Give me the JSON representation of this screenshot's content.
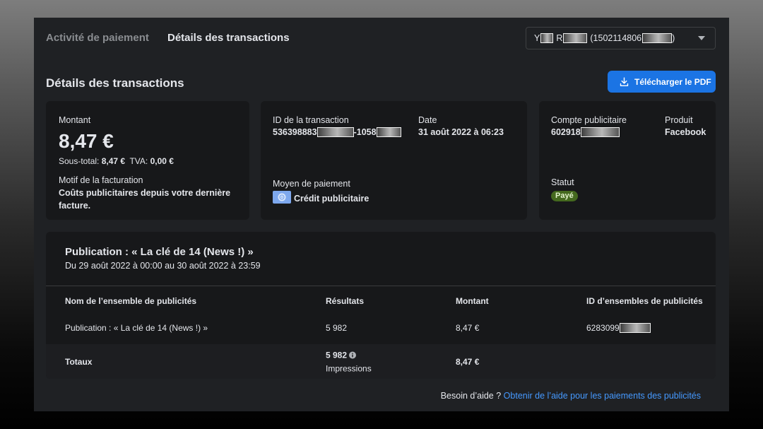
{
  "tabs": {
    "payment_activity": "Activité de paiement",
    "transaction_details": "Détails des transactions"
  },
  "account_selector": {
    "first_initial": "Y",
    "second_initial": "R",
    "account_id_visible": "(1502114806",
    "closing": ")",
    "icon": "chevron-down-icon"
  },
  "page_title": "Détails des transactions",
  "download_button": {
    "label": "Télécharger le PDF",
    "icon": "download-icon"
  },
  "amount_card": {
    "label": "Montant",
    "amount": "8,47 €",
    "subtotal_label": "Sous-total:",
    "subtotal_value": "8,47 €",
    "vat_label": "TVA:",
    "vat_value": "0,00 €",
    "reason_label": "Motif de la facturation",
    "reason_value": "Coûts publicitaires depuis votre dernière facture."
  },
  "transaction_card": {
    "id_label": "ID de la transaction",
    "id_visible_start": "536398883",
    "id_visible_middle": "-1058",
    "date_label": "Date",
    "date_value": "31 août 2022 à 06:23",
    "payment_method_label": "Moyen de paiement",
    "payment_method_value": "Crédit publicitaire",
    "payment_method_icon": "ad-credit-icon"
  },
  "account_card": {
    "account_label": "Compte publicitaire",
    "account_visible_start": "602918",
    "product_label": "Produit",
    "product_value": "Facebook",
    "status_label": "Statut",
    "status_value": "Payé"
  },
  "campaign": {
    "title": "Publication : « La clé de 14 (News !) »",
    "date_range": "Du 29 août 2022 à 00:00 au 30 août 2022 à 23:59",
    "columns": [
      "Nom de l’ensemble de publicités",
      "Résultats",
      "Montant",
      "ID d’ensembles de publicités"
    ],
    "rows": [
      {
        "name": "Publication : « La clé de 14 (News !) »",
        "results": "5 982",
        "amount": "8,47 €",
        "id_visible_start": "6283099"
      }
    ],
    "totals": {
      "label": "Totaux",
      "results": "5 982",
      "results_unit": "Impressions",
      "results_icon": "info-icon",
      "amount": "8,47 €"
    }
  },
  "help": {
    "prefix": "Besoin d’aide ?",
    "link": "Obtenir de l’aide pour les paiements des publicités"
  },
  "colors": {
    "accent": "#1b74e4",
    "link": "#4599ff",
    "status_badge_bg": "#44691e",
    "status_badge_text": "#e1f2cb"
  }
}
